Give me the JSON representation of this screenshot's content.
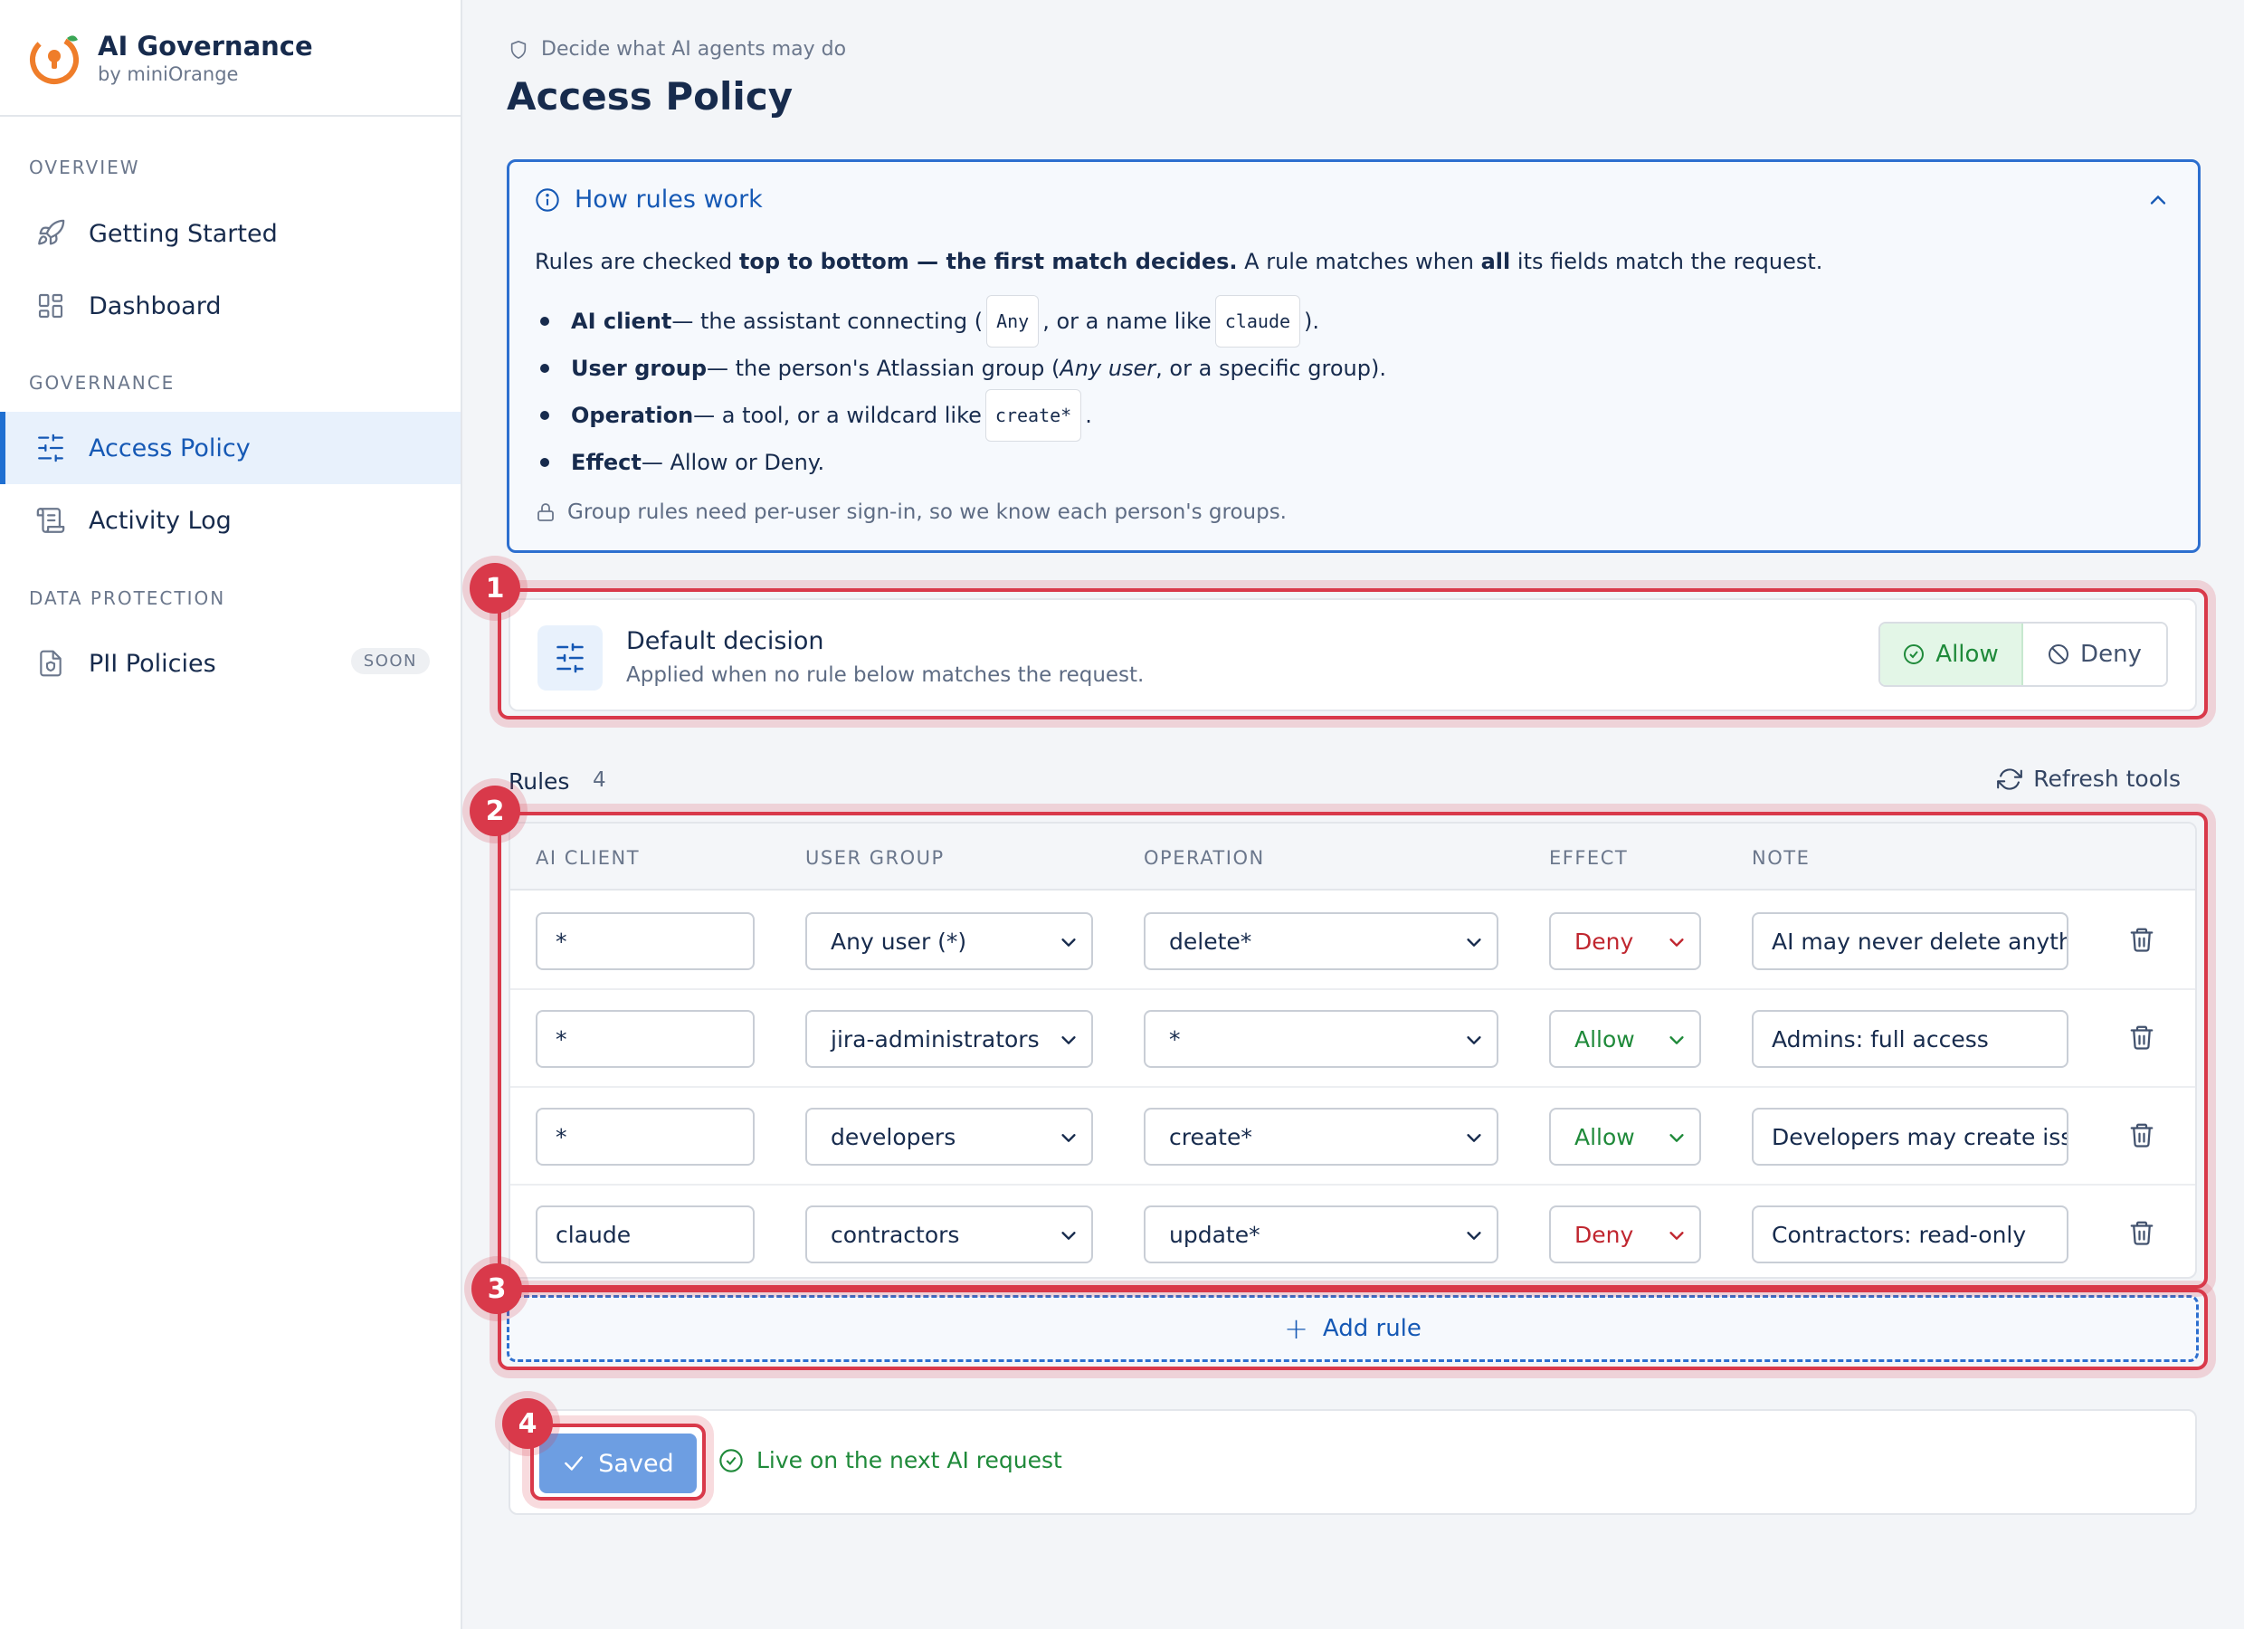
{
  "brand": {
    "title": "AI Governance",
    "subtitle": "by miniOrange"
  },
  "sidebar": {
    "sections": [
      "OVERVIEW",
      "GOVERNANCE",
      "DATA PROTECTION"
    ],
    "items": [
      {
        "label": "Getting Started",
        "icon": "rocket-icon"
      },
      {
        "label": "Dashboard",
        "icon": "grid-icon"
      },
      {
        "label": "Access Policy",
        "icon": "sliders-icon",
        "active": true
      },
      {
        "label": "Activity Log",
        "icon": "scroll-icon"
      },
      {
        "label": "PII Policies",
        "icon": "shield-doc-icon",
        "badge": "SOON"
      }
    ]
  },
  "header": {
    "breadcrumb": "Decide what AI agents may do",
    "title": "Access Policy"
  },
  "info": {
    "title": "How rules work",
    "intro_1": "Rules are checked ",
    "intro_bold": "top to bottom — the first match decides.",
    "intro_2": " A rule matches when ",
    "intro_all": "all",
    "intro_3": " its fields match the request.",
    "b1_term": "AI client",
    "b1_a": " — the assistant connecting (",
    "b1_code1": "Any",
    "b1_b": ", or a name like",
    "b1_code2": "claude",
    "b1_c": ").",
    "b2_term": "User group",
    "b2_a": " — the person's Atlassian group (",
    "b2_em": "Any user",
    "b2_b": ", or a specific group).",
    "b3_term": "Operation",
    "b3_a": " — a tool, or a wildcard like",
    "b3_code": "create*",
    "b3_b": ".",
    "b4_term": "Effect",
    "b4_a": " — Allow or Deny.",
    "note": "Group rules need per-user sign-in, so we know each person's groups."
  },
  "callouts": [
    "1",
    "2",
    "3",
    "4"
  ],
  "decision": {
    "title": "Default decision",
    "subtitle": "Applied when no rule below matches the request.",
    "allow": "Allow",
    "deny": "Deny",
    "selected": "Allow"
  },
  "rules": {
    "label": "Rules",
    "count": "4",
    "refresh": "Refresh tools",
    "headers": [
      "AI CLIENT",
      "USER GROUP",
      "OPERATION",
      "EFFECT",
      "NOTE"
    ],
    "rows": [
      {
        "client": "*",
        "group": "Any user (*)",
        "operation": "delete*",
        "effect": "Deny",
        "note": "AI may never delete anythi"
      },
      {
        "client": "*",
        "group": "jira-administrators",
        "operation": "*",
        "effect": "Allow",
        "note": "Admins: full access"
      },
      {
        "client": "*",
        "group": "developers",
        "operation": "create*",
        "effect": "Allow",
        "note": "Developers may create issu"
      },
      {
        "client": "claude",
        "group": "contractors",
        "operation": "update*",
        "effect": "Deny",
        "note": "Contractors: read-only"
      }
    ],
    "add": "Add rule"
  },
  "save": {
    "button": "Saved",
    "status": "Live on the next AI request"
  },
  "colors": {
    "accent": "#1f6fd1",
    "allow": "#1f8a3a",
    "deny": "#c0262f",
    "highlight": "#d9394a",
    "brand_orange": "#ef7d2a"
  }
}
